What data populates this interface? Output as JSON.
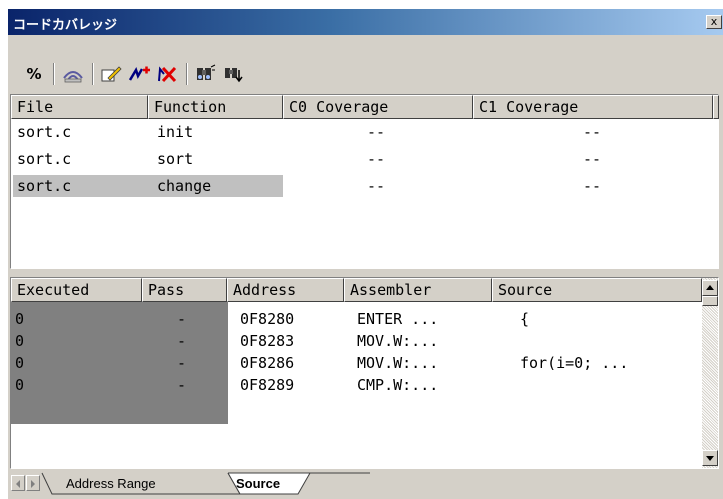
{
  "window": {
    "title": "コードカバレッジ",
    "close_glyph": "x"
  },
  "toolbar": {
    "percent_label": "%",
    "icons": [
      "coverage-range-icon",
      "edit-icon",
      "add-icon",
      "delete-icon",
      "find-icon",
      "find-next-icon"
    ]
  },
  "function_table": {
    "headers": [
      "File",
      "Function",
      "C0 Coverage",
      "C1 Coverage"
    ],
    "rows": [
      {
        "file": "sort.c",
        "function": "init",
        "c0": "--",
        "c1": "--"
      },
      {
        "file": "sort.c",
        "function": "sort",
        "c0": "--",
        "c1": "--"
      },
      {
        "file": "sort.c",
        "function": "change",
        "c0": "--",
        "c1": "--"
      }
    ]
  },
  "source_table": {
    "headers": [
      "Executed",
      "Pass",
      "Address",
      "Assembler",
      "Source"
    ],
    "rows": [
      {
        "executed": "0",
        "pass": "-",
        "address": "0F8280",
        "assembler": "ENTER ...",
        "source": "{"
      },
      {
        "executed": "0",
        "pass": "-",
        "address": "0F8283",
        "assembler": "MOV.W:...",
        "source": ""
      },
      {
        "executed": "0",
        "pass": "-",
        "address": "0F8286",
        "assembler": "MOV.W:...",
        "source": "for(i=0; ..."
      },
      {
        "executed": "0",
        "pass": "-",
        "address": "0F8289",
        "assembler": "CMP.W:...",
        "source": ""
      }
    ]
  },
  "tabs": [
    "Address Range",
    "Source"
  ],
  "colors": {
    "title_start": "#0a246a",
    "title_end": "#a6caf0",
    "face": "#d4d0c8",
    "executed_bg": "#808080",
    "selected_row": "#c0c0c0"
  }
}
